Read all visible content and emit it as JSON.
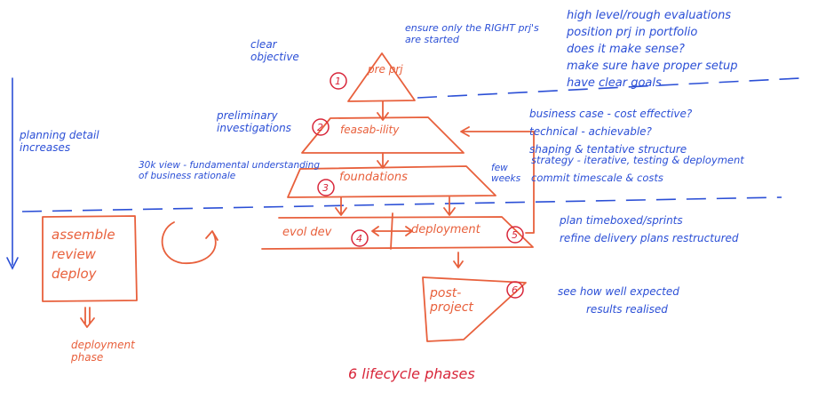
{
  "diagram": {
    "title": "6 lifecycle phases",
    "phases": [
      {
        "number": "1",
        "label": "pre prj"
      },
      {
        "number": "2",
        "label": "feasab-ility"
      },
      {
        "number": "3",
        "label": "foundations"
      },
      {
        "number": "4",
        "label": "evol dev"
      },
      {
        "number": "5",
        "label": "deployment"
      },
      {
        "number": "6",
        "label": "post-project"
      }
    ],
    "side_loop": {
      "label": "assemble review deploy",
      "caption": "deployment phase"
    },
    "left_axis_label": "planning detail increases",
    "annotations": {
      "clear_objective": "clear objective",
      "ensure_right": "ensure only the RIGHT prj's are started",
      "high_level": [
        "high level/rough evaluations",
        "position prj in portfolio",
        "does it make sense?",
        "make sure have proper setup",
        "have clear goals"
      ],
      "preliminary": "preliminary investigations",
      "feasibility_notes": [
        "business case - cost effective?",
        "technical - achievable?",
        "shaping & tentative structure"
      ],
      "foundations_left": "30k view - fundamental understanding of business rationale",
      "few_weeks": "few weeks",
      "foundations_notes": [
        "strategy - iterative, testing & deployment",
        "commit timescale & costs"
      ],
      "evol_notes": [
        "plan timeboxed/sprints",
        "refine delivery plans restructured"
      ],
      "post_notes": [
        "see how well expected",
        "results realised"
      ]
    }
  }
}
